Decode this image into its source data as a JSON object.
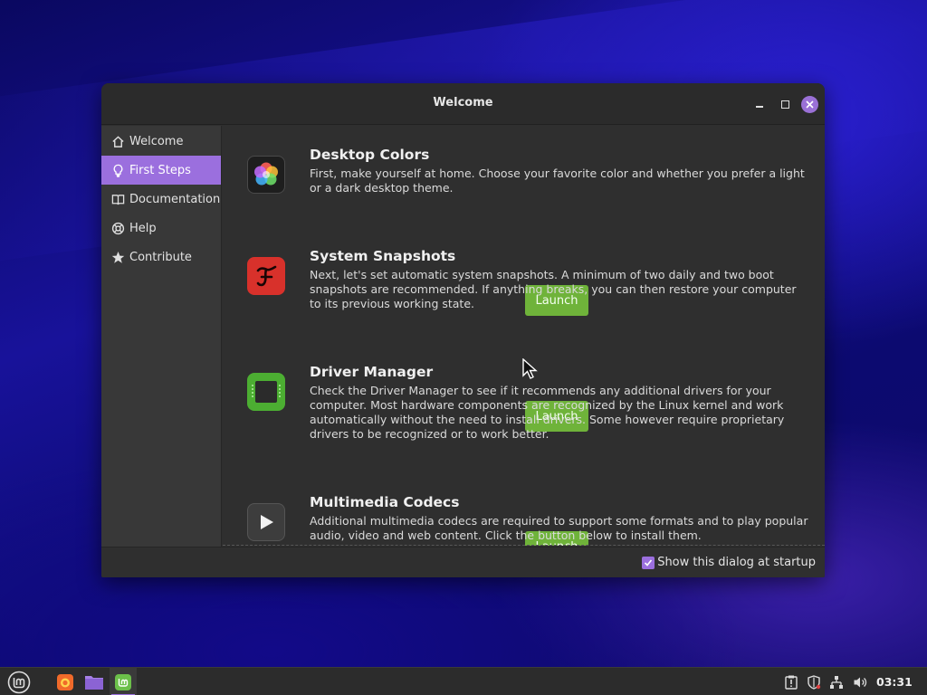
{
  "window": {
    "title": "Welcome",
    "footer": {
      "show_at_startup_label": "Show this dialog at startup",
      "show_at_startup_checked": true
    }
  },
  "sidebar": {
    "items": [
      {
        "label": "Welcome",
        "icon": "home-icon",
        "active": false
      },
      {
        "label": "First Steps",
        "icon": "lightbulb-icon",
        "active": true
      },
      {
        "label": "Documentation",
        "icon": "book-icon",
        "active": false
      },
      {
        "label": "Help",
        "icon": "lifebuoy-icon",
        "active": false
      },
      {
        "label": "Contribute",
        "icon": "star-icon",
        "active": false
      }
    ]
  },
  "entries": [
    {
      "title": "Desktop Colors",
      "description": "First, make yourself at home. Choose your favorite color and whether you prefer a light or a dark desktop theme.",
      "button": "Launch",
      "icon": "color-flower-icon"
    },
    {
      "title": "System Snapshots",
      "description": "Next, let's set automatic system snapshots. A minimum of two daily and two boot snapshots are recommended. If anything breaks, you can then restore your computer to its previous working state.",
      "button": "Launch",
      "icon": "timeshift-icon"
    },
    {
      "title": "Driver Manager",
      "description": "Check the Driver Manager to see if it recommends any additional drivers for your computer. Most hardware components are recognized by the Linux kernel and work automatically without the need to install drivers. Some however require proprietary drivers to be recognized or to work better.",
      "button": "Launch",
      "icon": "chip-icon"
    },
    {
      "title": "Multimedia Codecs",
      "description": "Additional multimedia codecs are required to support some formats and to play popular audio, video and web content. Click the button below to install them.",
      "button": "Launch",
      "icon": "play-icon"
    }
  ],
  "taskbar": {
    "clock": "03:31",
    "launchers": [
      "menu-icon",
      "firefox-icon",
      "files-icon",
      "welcome-app-icon"
    ],
    "tray": [
      "update-icon",
      "shield-icon",
      "network-icon",
      "volume-icon"
    ]
  },
  "colors": {
    "accent": "#9b6fde",
    "launch_button": "#6fb33a"
  }
}
